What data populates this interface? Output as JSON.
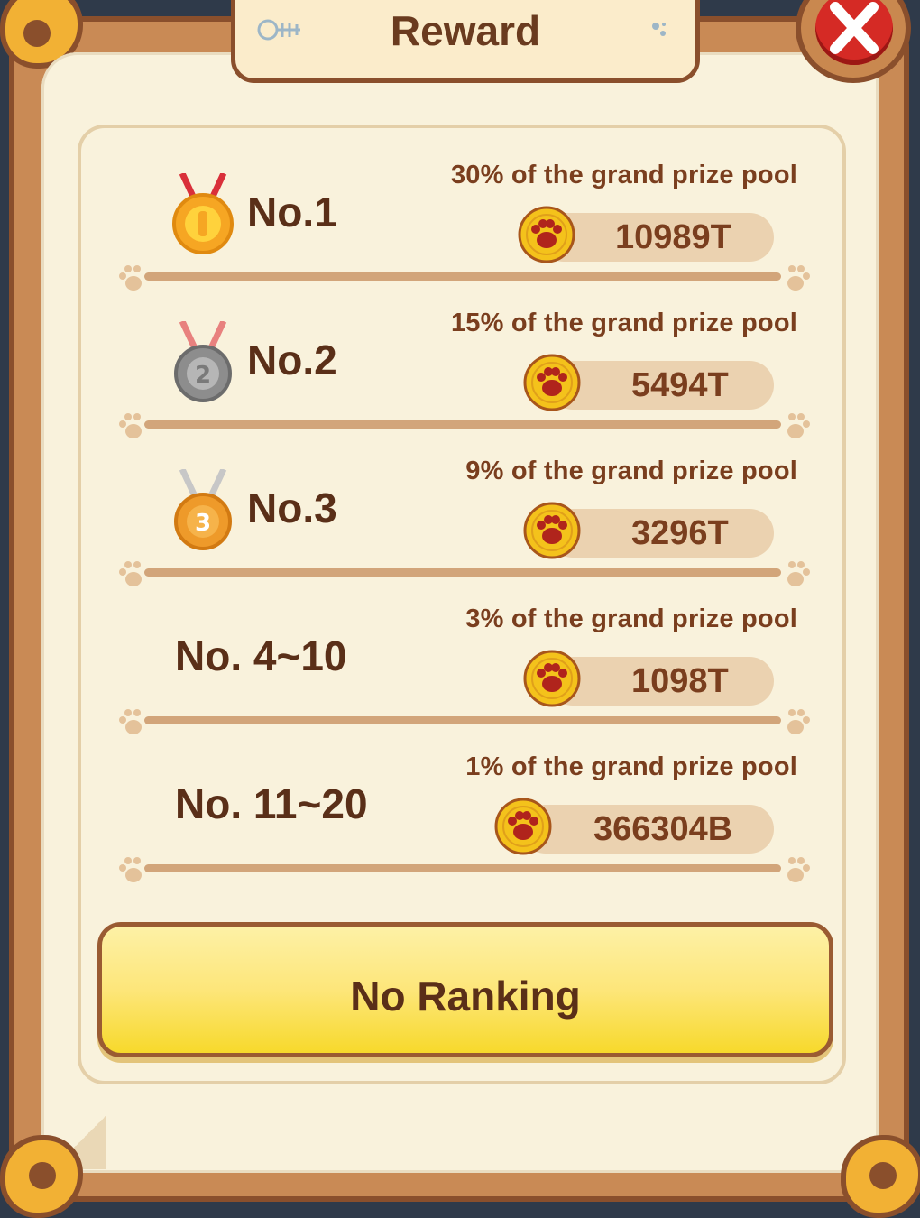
{
  "dialog": {
    "title": "Reward",
    "close_icon": "close-x-icon"
  },
  "colors": {
    "frame": "#c98a55",
    "paper": "#f9f2dc",
    "text": "#5a2f18",
    "pill": "#ebd2b0",
    "button": "#f7d92b"
  },
  "rewards": [
    {
      "rank": "No.1",
      "medal": "gold-medal-icon",
      "pool": "30% of the grand prize pool",
      "amount": "10989T"
    },
    {
      "rank": "No.2",
      "medal": "silver-medal-icon",
      "pool": "15% of the grand prize pool",
      "amount": "5494T"
    },
    {
      "rank": "No.3",
      "medal": "bronze-medal-icon",
      "pool": "9% of the grand prize pool",
      "amount": "3296T"
    },
    {
      "rank": "No. 4~10",
      "medal": "",
      "pool": "3% of the grand prize pool",
      "amount": "1098T"
    },
    {
      "rank": "No. 11~20",
      "medal": "",
      "pool": "1% of the grand prize pool",
      "amount": "366304B"
    }
  ],
  "footer": {
    "button_label": "No Ranking"
  }
}
